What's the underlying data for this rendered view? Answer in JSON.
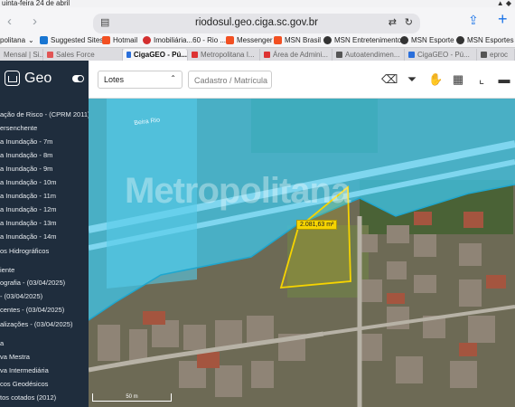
{
  "status": {
    "date": "uinta-feira 24 de abril",
    "indicators": "▲ ◆"
  },
  "browser": {
    "url": "riodosul.geo.ciga.sc.gov.br",
    "favorites": [
      {
        "label": "politana",
        "color": "#3b6bd6"
      },
      {
        "label": "Suggested Sites",
        "color": "#1976d2"
      },
      {
        "label": "Hotmail",
        "color": "#f25022"
      },
      {
        "label": "Imobiliária...60 - Rio ...",
        "color": "#d32f2f"
      },
      {
        "label": "Messenger",
        "color": "#f25022"
      },
      {
        "label": "MSN Brasil",
        "color": "#f25022"
      },
      {
        "label": "MSN Entretenimento",
        "color": "#333333"
      },
      {
        "label": "MSN Esporte",
        "color": "#333333"
      },
      {
        "label": "MSN Esportes",
        "color": "#333333"
      }
    ],
    "tabs": [
      {
        "label": "Mensal | Si...",
        "color": "#888888"
      },
      {
        "label": "Sales Force",
        "color": "#e25555"
      },
      {
        "label": "CigaGEO - Pú...",
        "color": "#2a6fdb"
      },
      {
        "label": "Metropolitana I...",
        "color": "#d33"
      },
      {
        "label": "Área de Admini...",
        "color": "#d33"
      },
      {
        "label": "Autoatendimen...",
        "color": "#555555"
      },
      {
        "label": "CigaGEO - Pú...",
        "color": "#2a6fdb"
      },
      {
        "label": "eproc",
        "color": "#555555"
      }
    ]
  },
  "app": {
    "name": "Geo",
    "layer_select": "Lotes",
    "search_placeholder": "Cadastro / Matrícula"
  },
  "sidebar": {
    "items": [
      "ação de Risco - (CPRM 2011)",
      "ersenchente",
      "a Inundação - 7m",
      "a Inundação - 8m",
      "a Inundação - 9m",
      "a Inundação - 10m",
      "a Inundação - 11m",
      "a Inundação - 12m",
      "a Inundação - 13m",
      "a Inundação - 14m",
      "os Hidrográficos",
      "iente",
      "ografia - (03/04/2025)",
      "- (03/04/2025)",
      "centes - (03/04/2025)",
      "alizações - (03/04/2025)",
      "a",
      "va Mestra",
      "va Intermediária",
      "cos Geodésicos",
      "tos cotados (2012)"
    ]
  },
  "map": {
    "watermark": "Metropolitana",
    "road_label": "Beira Rio",
    "area_label": "2.081,63 m²",
    "scale_label": "50 m"
  },
  "colors": {
    "sidebar": "#1f2d3d",
    "flood": "#3fc3e6",
    "parcel": "#f6d400"
  }
}
